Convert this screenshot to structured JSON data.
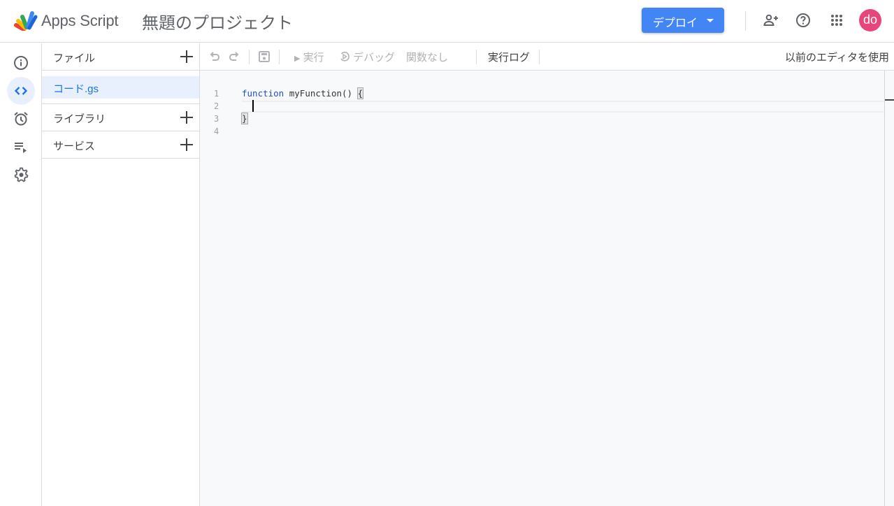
{
  "header": {
    "app_name": "Apps Script",
    "project_title": "無題のプロジェクト",
    "deploy_label": "デプロイ",
    "avatar_initials": "do",
    "accent_color": "#4285f4",
    "avatar_color": "#e8457b"
  },
  "rail": {
    "items": [
      {
        "name": "overview",
        "icon": "info-icon"
      },
      {
        "name": "editor",
        "icon": "code-icon",
        "active": true
      },
      {
        "name": "triggers",
        "icon": "alarm-clock-icon"
      },
      {
        "name": "executions",
        "icon": "executions-list-icon"
      },
      {
        "name": "settings",
        "icon": "gear-icon"
      }
    ]
  },
  "files_panel": {
    "files_label": "ファイル",
    "files": [
      "コード.gs"
    ],
    "libraries_label": "ライブラリ",
    "services_label": "サービス"
  },
  "toolbar": {
    "run_label": "実行",
    "debug_label": "デバッグ",
    "function_select": "関数なし",
    "execution_log_label": "実行ログ",
    "legacy_editor_label": "以前のエディタを使用"
  },
  "editor": {
    "line_numbers": [
      "1",
      "2",
      "3",
      "4"
    ],
    "lines": {
      "l1_keyword": "function",
      "l1_rest": " myFunction() ",
      "l1_brace": "{",
      "l3_brace": "}"
    }
  }
}
